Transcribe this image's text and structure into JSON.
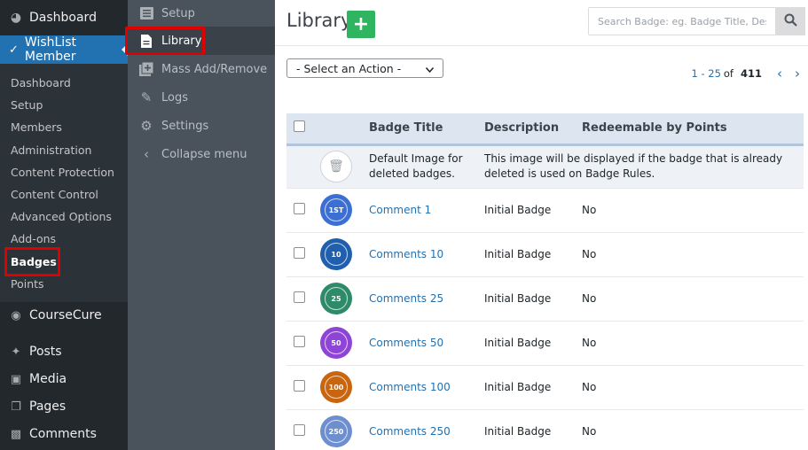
{
  "wp_sidebar": {
    "dashboard": "Dashboard",
    "wlm": "WishList Member",
    "submenu": [
      "Dashboard",
      "Setup",
      "Members",
      "Administration",
      "Content Protection",
      "Content Control",
      "Advanced Options",
      "Add-ons",
      "Badges",
      "Points"
    ],
    "coursecure": "CourseCure",
    "posts": "Posts",
    "media": "Media",
    "pages": "Pages",
    "comments": "Comments"
  },
  "plugin_nav": {
    "setup": "Setup",
    "library": "Library",
    "mass_add_remove": "Mass Add/Remove",
    "logs": "Logs",
    "settings": "Settings",
    "collapse": "Collapse menu"
  },
  "page": {
    "title": "Library",
    "add_symbol": "+",
    "search_placeholder": "Search Badge: eg. Badge Title, Description"
  },
  "toolbar": {
    "action_select": "- Select an Action -",
    "pager_range": "1 - 25",
    "pager_of": "of",
    "pager_total": "411"
  },
  "table": {
    "headers": {
      "title": "Badge Title",
      "description": "Description",
      "redeemable": "Redeemable by Points"
    },
    "default_row": {
      "title": "Default Image for deleted badges.",
      "description": "This image will be displayed if the badge that is already deleted is used on Badge Rules."
    },
    "rows": [
      {
        "badge_text": "1ST",
        "color": "#3b6fd4",
        "title": "Comment 1",
        "description": "Initial Badge",
        "redeemable": "No"
      },
      {
        "badge_text": "10",
        "color": "#1f5fae",
        "title": "Comments 10",
        "description": "Initial Badge",
        "redeemable": "No"
      },
      {
        "badge_text": "25",
        "color": "#2e8b6a",
        "title": "Comments 25",
        "description": "Initial Badge",
        "redeemable": "No"
      },
      {
        "badge_text": "50",
        "color": "#8e44d6",
        "title": "Comments 50",
        "description": "Initial Badge",
        "redeemable": "No"
      },
      {
        "badge_text": "100",
        "color": "#c9650f",
        "title": "Comments 100",
        "description": "Initial Badge",
        "redeemable": "No"
      },
      {
        "badge_text": "250",
        "color": "#6d8fd0",
        "title": "Comments 250",
        "description": "Initial Badge",
        "redeemable": "No"
      }
    ]
  }
}
